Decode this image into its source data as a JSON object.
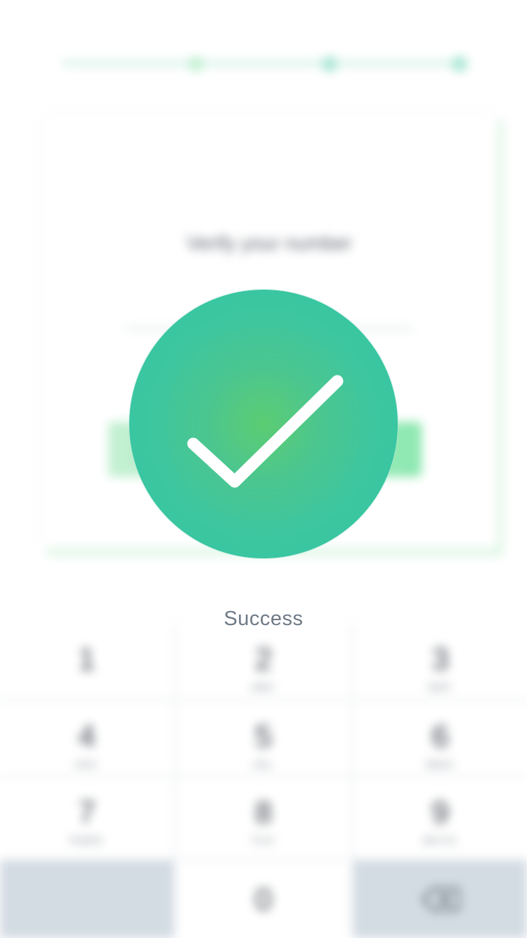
{
  "background_screen": {
    "stepper": {
      "steps": 3,
      "current_step": 1
    },
    "card": {
      "title": "Verify your number",
      "input_value": "",
      "button_label": ""
    },
    "keypad": {
      "keys": [
        {
          "digit": "1",
          "letters": ""
        },
        {
          "digit": "2",
          "letters": "ABC"
        },
        {
          "digit": "3",
          "letters": "DEF"
        },
        {
          "digit": "4",
          "letters": "GHI"
        },
        {
          "digit": "5",
          "letters": "JKL"
        },
        {
          "digit": "6",
          "letters": "MNO"
        },
        {
          "digit": "7",
          "letters": "PQRS"
        },
        {
          "digit": "8",
          "letters": "TUV"
        },
        {
          "digit": "9",
          "letters": "WXYZ"
        }
      ],
      "zero": "0",
      "delete_icon": "backspace-icon"
    }
  },
  "overlay": {
    "icon": "checkmark-icon",
    "label": "Success"
  },
  "colors": {
    "brand_green": "#3dc6a0",
    "brand_light_green": "#5ccc73",
    "label_gray": "#6f7a86",
    "keypad_dark_key": "#d3dbe3"
  }
}
